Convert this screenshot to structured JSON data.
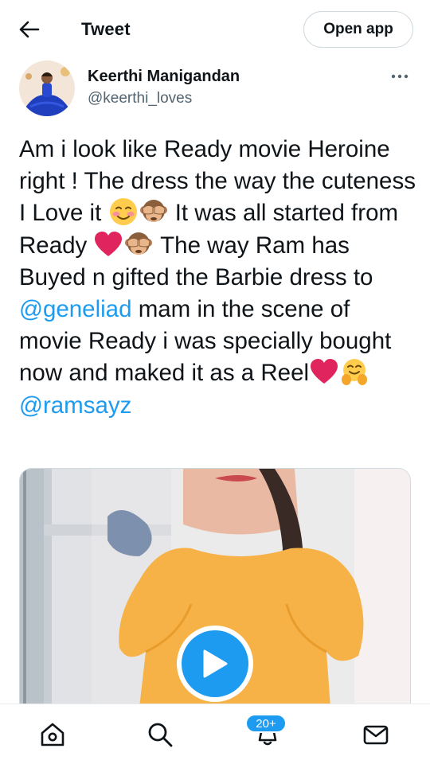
{
  "header": {
    "back_icon": "arrow-left-icon",
    "title": "Tweet",
    "open_app_label": "Open app"
  },
  "author": {
    "name": "Keerthi Manigandan",
    "handle": "@keerthi_loves",
    "more_icon": "more-horizontal-icon"
  },
  "tweet": {
    "text_parts": {
      "p1": "Am i look like Ready movie Heroine right ! The dress the way the cuteness I Love it ",
      "p2": " It was all started from Ready ",
      "p3": " The way Ram has Buyed n gifted the Barbie dress to ",
      "mention1": "@geneliad",
      "p4": " mam in the scene of movie Ready i was specially bought now and maked it as a Reel",
      "mention2": "@ramsayz"
    },
    "emojis": [
      "smiling-blushing-emoji",
      "see-no-evil-monkey-emoji",
      "red-heart-emoji",
      "see-no-evil-monkey-emoji",
      "red-heart-emoji",
      "hugging-face-emoji"
    ]
  },
  "media": {
    "type": "video",
    "play_icon": "play-icon"
  },
  "bottom_nav": {
    "items": [
      "home-icon",
      "search-icon",
      "notifications-icon",
      "messages-icon"
    ],
    "notification_badge": "20+"
  },
  "colors": {
    "accent": "#1d9bf0",
    "text": "#0f1419",
    "secondary_text": "#536471",
    "heart": "#e0245e",
    "emoji_yellow": "#ffcc4d",
    "dress_orange": "#f7b247"
  }
}
